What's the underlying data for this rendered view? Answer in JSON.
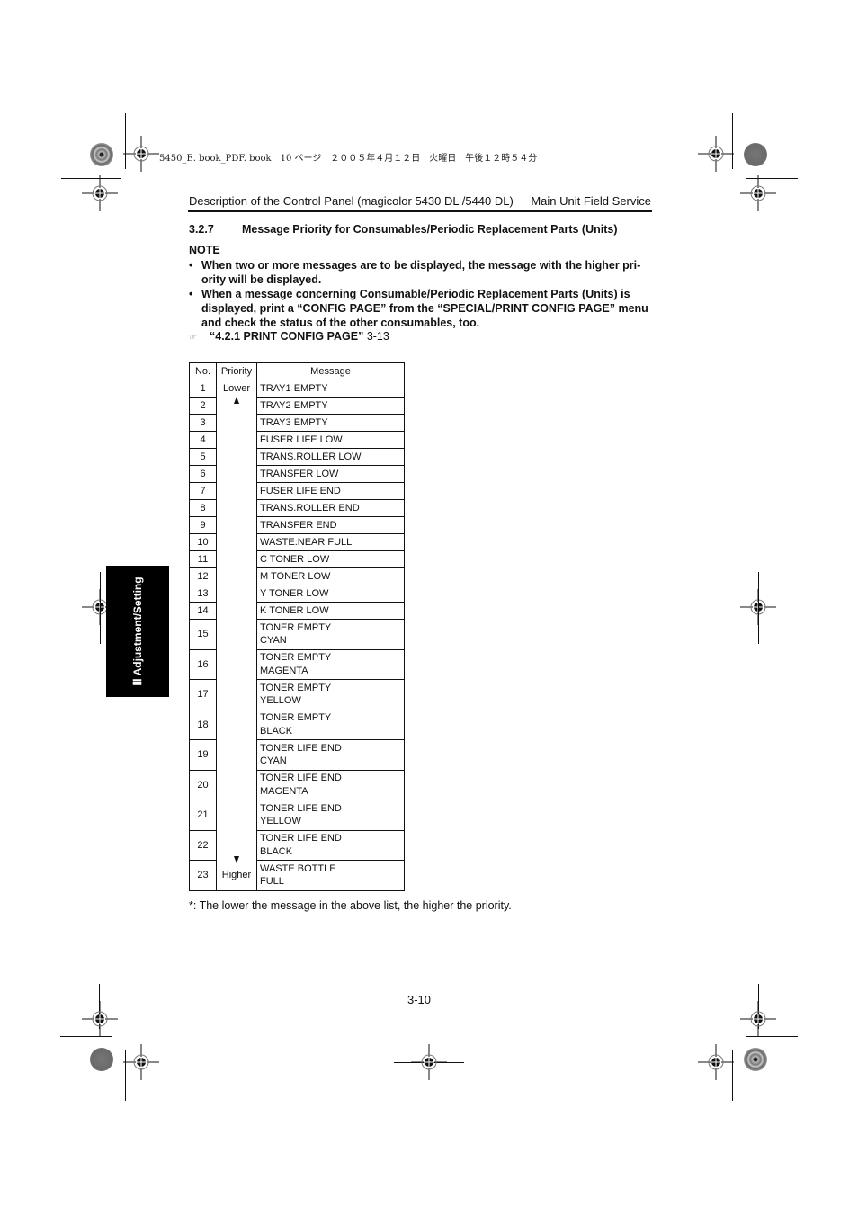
{
  "print_header": "5450_E. book_PDF. book　10 ページ　２００５年４月１２日　火曜日　午後１２時５４分",
  "running_head": {
    "left": "Description of the Control Panel (magicolor 5430 DL /5440 DL)",
    "right": "Main Unit Field Service"
  },
  "section": {
    "number": "3.2.7",
    "title": "Message Priority for Consumables/Periodic Replacement Parts (Units)"
  },
  "note": {
    "label": "NOTE",
    "bullets": [
      "When two or more messages are to be displayed, the message with the higher pri-ority will be displayed.",
      "When a message concerning Consumable/Periodic Replacement Parts (Units) is displayed, print a “CONFIG PAGE” from the “SPECIAL/PRINT CONFIG PAGE” menu and check the status of the other consumables, too."
    ],
    "bullet_symbol": "•"
  },
  "reference": {
    "icon": "pointing-hand-icon",
    "symbol": "☞",
    "title": "“4.2.1 PRINT CONFIG PAGE”",
    "page": "3-13"
  },
  "table": {
    "headers": [
      "No.",
      "Priority",
      "Message"
    ],
    "priority_top": "Lower",
    "priority_bottom": "Higher",
    "rows": [
      {
        "no": "1",
        "line1": "TRAY1 EMPTY",
        "line2": ""
      },
      {
        "no": "2",
        "line1": "TRAY2 EMPTY",
        "line2": ""
      },
      {
        "no": "3",
        "line1": "TRAY3 EMPTY",
        "line2": ""
      },
      {
        "no": "4",
        "line1": "FUSER LIFE LOW",
        "line2": ""
      },
      {
        "no": "5",
        "line1": "TRANS.ROLLER LOW",
        "line2": ""
      },
      {
        "no": "6",
        "line1": "TRANSFER LOW",
        "line2": ""
      },
      {
        "no": "7",
        "line1": "FUSER LIFE END",
        "line2": ""
      },
      {
        "no": "8",
        "line1": "TRANS.ROLLER END",
        "line2": ""
      },
      {
        "no": "9",
        "line1": "TRANSFER END",
        "line2": ""
      },
      {
        "no": "10",
        "line1": "WASTE:NEAR FULL",
        "line2": ""
      },
      {
        "no": "11",
        "line1": "C TONER LOW",
        "line2": ""
      },
      {
        "no": "12",
        "line1": "M TONER LOW",
        "line2": ""
      },
      {
        "no": "13",
        "line1": "Y TONER LOW",
        "line2": ""
      },
      {
        "no": "14",
        "line1": "K TONER LOW",
        "line2": ""
      },
      {
        "no": "15",
        "line1": "TONER EMPTY",
        "line2": "CYAN"
      },
      {
        "no": "16",
        "line1": "TONER EMPTY",
        "line2": "MAGENTA"
      },
      {
        "no": "17",
        "line1": "TONER EMPTY",
        "line2": "YELLOW"
      },
      {
        "no": "18",
        "line1": "TONER EMPTY",
        "line2": "BLACK"
      },
      {
        "no": "19",
        "line1": "TONER LIFE END",
        "line2": "CYAN"
      },
      {
        "no": "20",
        "line1": "TONER LIFE END",
        "line2": "MAGENTA"
      },
      {
        "no": "21",
        "line1": "TONER LIFE END",
        "line2": "YELLOW"
      },
      {
        "no": "22",
        "line1": "TONER LIFE END",
        "line2": "BLACK"
      },
      {
        "no": "23",
        "line1": "WASTE BOTTLE",
        "line2": "FULL"
      }
    ]
  },
  "footnote": "*: The lower the message in the above list, the higher the priority.",
  "page_number": "3-10",
  "side_tab": "Ⅲ Adjustment/Setting"
}
